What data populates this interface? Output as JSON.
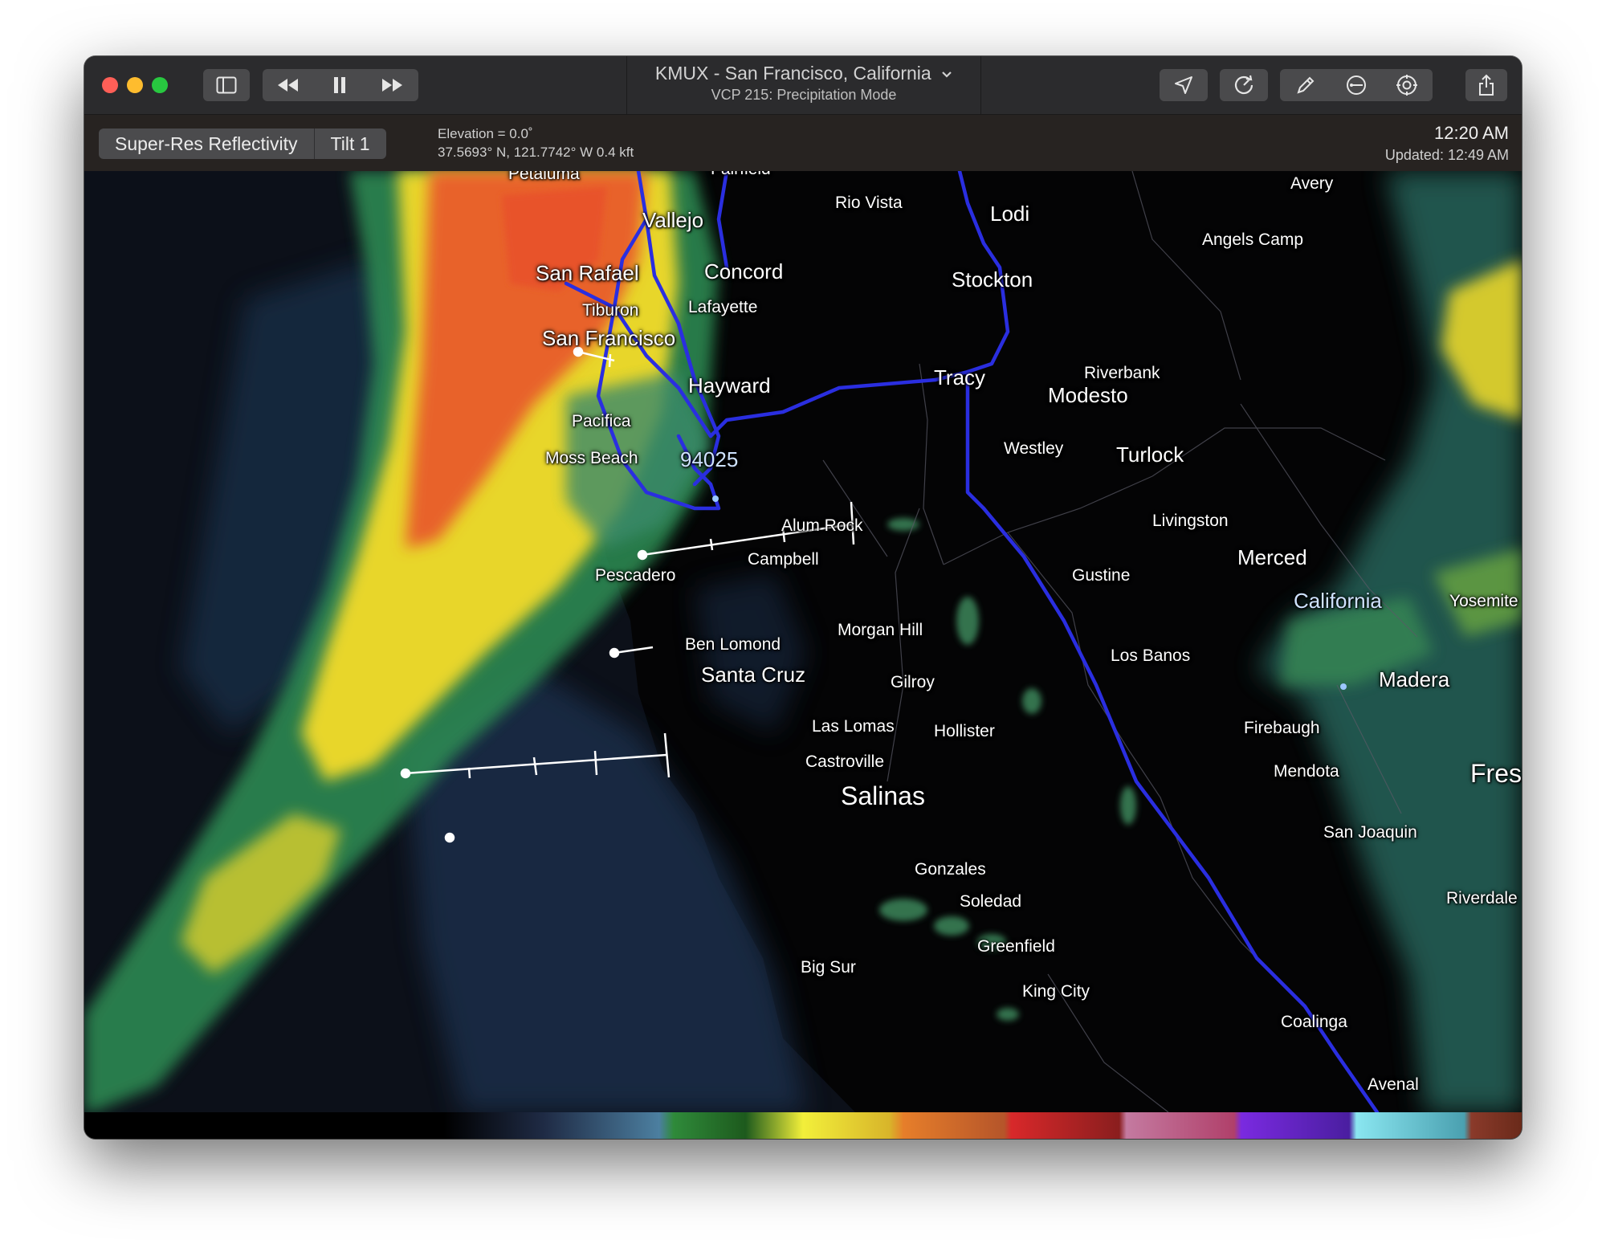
{
  "window": {
    "title": "KMUX - San Francisco, California",
    "subtitle": "VCP 215: Precipitation Mode"
  },
  "toolbar": {
    "product_label": "Super-Res Reflectivity",
    "tilt_label": "Tilt 1",
    "elevation": "Elevation = 0.0˚",
    "coordinates": "37.5693° N, 121.7742° W 0.4 kft",
    "time": "12:20 AM",
    "updated": "Updated: 12:49 AM"
  },
  "icons": {
    "sidebar": "sidebar-toggle-icon",
    "rewind": "rewind-icon",
    "pause": "pause-icon",
    "forward": "fast-forward-icon",
    "location": "location-arrow-icon",
    "refresh": "radar-refresh-icon",
    "pencil": "pencil-icon",
    "distance": "distance-tool-icon",
    "target": "target-icon",
    "share": "share-icon",
    "chevron": "chevron-down-icon"
  },
  "map": {
    "zip_label": "94025",
    "cities": {
      "petaluma": "Petaluma",
      "fairfield": "Fairfield",
      "vallejo": "Vallejo",
      "rio_vista": "Rio Vista",
      "lodi": "Lodi",
      "avery": "Avery",
      "angels_camp": "Angels Camp",
      "san_rafael": "San Rafael",
      "concord": "Concord",
      "stockton": "Stockton",
      "tiburon": "Tiburon",
      "lafayette": "Lafayette",
      "san_francisco": "San Francisco",
      "tracy": "Tracy",
      "riverbank": "Riverbank",
      "hayward": "Hayward",
      "modesto": "Modesto",
      "pacifica": "Pacifica",
      "westley": "Westley",
      "moss_beach": "Moss Beach",
      "turlock": "Turlock",
      "alum_rock": "Alum Rock",
      "livingston": "Livingston",
      "campbell": "Campbell",
      "merced": "Merced",
      "pescadero": "Pescadero",
      "gustine": "Gustine",
      "california": "California",
      "yosemite": "Yosemite",
      "morgan_hill": "Morgan Hill",
      "ben_lomond": "Ben Lomond",
      "los_banos": "Los Banos",
      "santa_cruz": "Santa Cruz",
      "gilroy": "Gilroy",
      "madera": "Madera",
      "las_lomas": "Las Lomas",
      "hollister": "Hollister",
      "firebaugh": "Firebaugh",
      "castroville": "Castroville",
      "mendota": "Mendota",
      "fresno": "Fres",
      "salinas": "Salinas",
      "san_joaquin": "San Joaquin",
      "gonzales": "Gonzales",
      "soledad": "Soledad",
      "riverdale": "Riverdale",
      "greenfield": "Greenfield",
      "big_sur": "Big Sur",
      "king_city": "King City",
      "coalinga": "Coalinga",
      "avenal": "Avenal"
    }
  },
  "colors": {
    "titlebar": "#2b2b2d",
    "highway": "#2a2ee0",
    "reflectivity_light": "#2f8f55",
    "reflectivity_moderate": "#e8d62a",
    "reflectivity_heavy": "#e8622a",
    "close": "#ff5f57",
    "minimize": "#febc2e",
    "zoom": "#28c840"
  }
}
